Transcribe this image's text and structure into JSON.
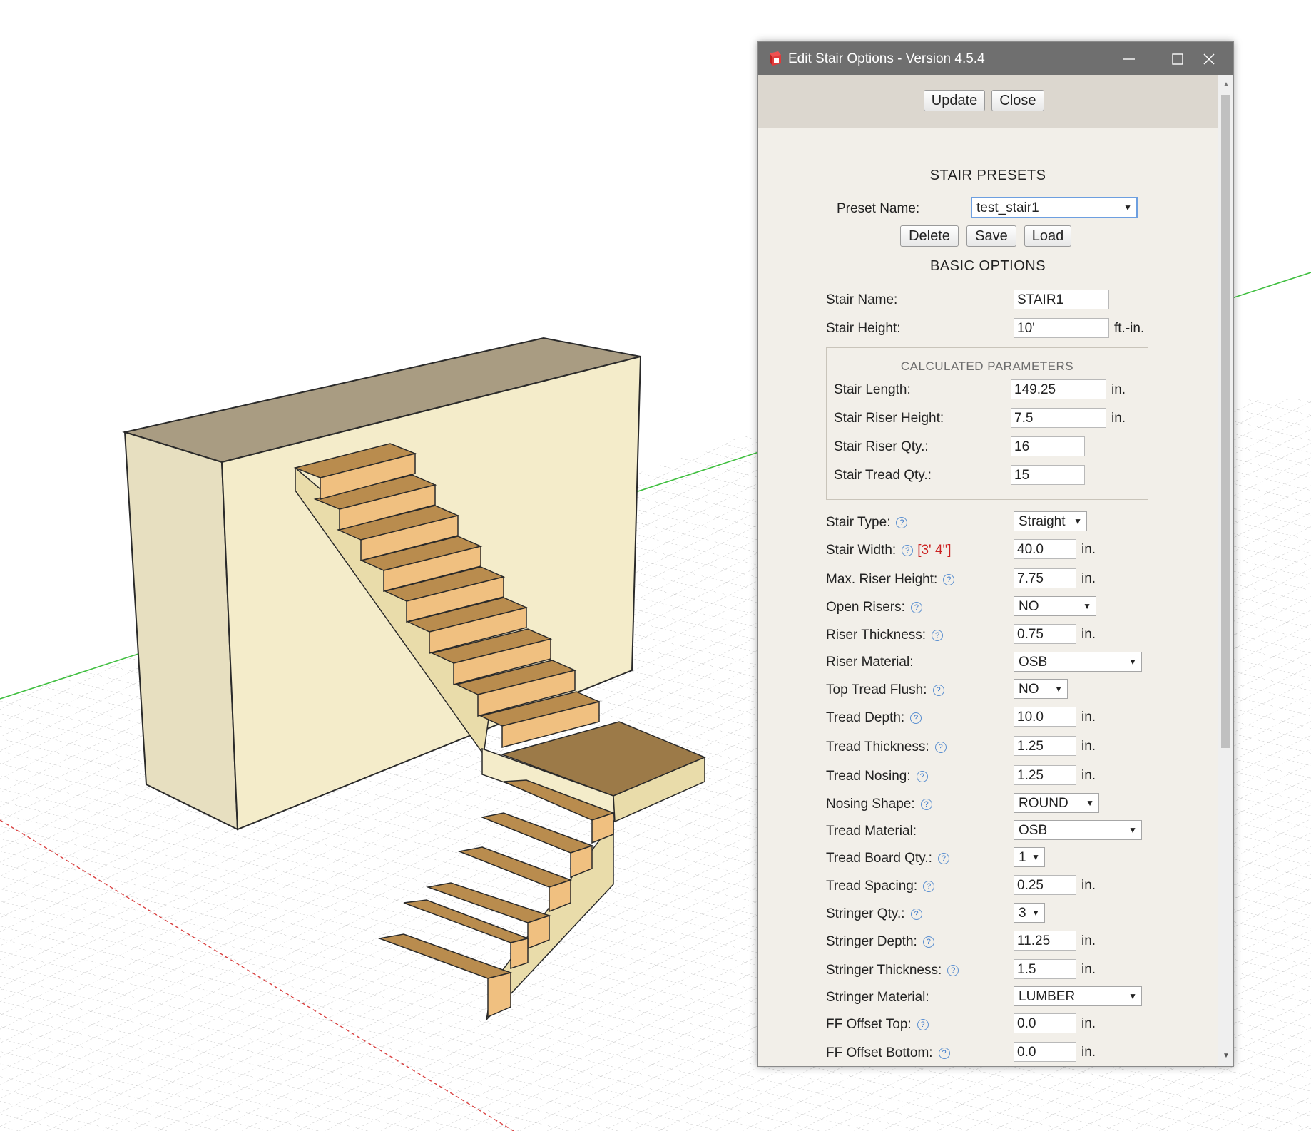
{
  "dialog": {
    "title": "Edit Stair Options - Version 4.5.4",
    "update_label": "Update",
    "close_label": "Close"
  },
  "presets": {
    "heading": "STAIR PRESETS",
    "preset_label": "Preset Name:",
    "preset_value": "test_stair1",
    "delete_label": "Delete",
    "save_label": "Save",
    "load_label": "Load"
  },
  "basic": {
    "heading": "BASIC OPTIONS",
    "stair_name_label": "Stair Name:",
    "stair_name_value": "STAIR1",
    "stair_height_label": "Stair Height:",
    "stair_height_value": "10'",
    "stair_height_unit": "ft.-in."
  },
  "calculated": {
    "heading": "CALCULATED PARAMETERS",
    "rows": [
      {
        "label": "Stair Length:",
        "value": "149.25",
        "unit": "in."
      },
      {
        "label": "Stair Riser Height:",
        "value": "7.5",
        "unit": "in."
      },
      {
        "label": "Stair Riser Qty.:",
        "value": "16"
      },
      {
        "label": "Stair Tread Qty.:",
        "value": "15"
      }
    ]
  },
  "options": {
    "stair_type": {
      "label": "Stair Type:",
      "value": "Straight"
    },
    "stair_width": {
      "label": "Stair Width:",
      "note": "[3' 4\"]",
      "value": "40.0",
      "unit": "in."
    },
    "max_riser_height": {
      "label": "Max. Riser Height:",
      "value": "7.75",
      "unit": "in."
    },
    "open_risers": {
      "label": "Open Risers:",
      "value": "NO"
    },
    "riser_thickness": {
      "label": "Riser Thickness:",
      "value": "0.75",
      "unit": "in."
    },
    "riser_material": {
      "label": "Riser Material:",
      "value": "OSB"
    },
    "top_tread_flush": {
      "label": "Top Tread Flush:",
      "value": "NO"
    },
    "tread_depth": {
      "label": "Tread Depth:",
      "value": "10.0",
      "unit": "in."
    },
    "tread_thickness": {
      "label": "Tread Thickness:",
      "value": "1.25",
      "unit": "in."
    },
    "tread_nosing": {
      "label": "Tread Nosing:",
      "value": "1.25",
      "unit": "in."
    },
    "nosing_shape": {
      "label": "Nosing Shape:",
      "value": "ROUND"
    },
    "tread_material": {
      "label": "Tread Material:",
      "value": "OSB"
    },
    "tread_board_qty": {
      "label": "Tread Board Qty.:",
      "value": "1"
    },
    "tread_spacing": {
      "label": "Tread Spacing:",
      "value": "0.25",
      "unit": "in."
    },
    "stringer_qty": {
      "label": "Stringer Qty.:",
      "value": "3"
    },
    "stringer_depth": {
      "label": "Stringer Depth:",
      "value": "11.25",
      "unit": "in."
    },
    "stringer_thickness": {
      "label": "Stringer Thickness:",
      "value": "1.5",
      "unit": "in."
    },
    "stringer_material": {
      "label": "Stringer Material:",
      "value": "LUMBER"
    },
    "ff_offset_top": {
      "label": "FF Offset Top:",
      "value": "0.0",
      "unit": "in."
    },
    "ff_offset_bottom": {
      "label": "FF Offset Bottom:",
      "value": "0.0",
      "unit": "in."
    }
  },
  "icons": {
    "help": "?",
    "dropdown": "▼",
    "scroll_up": "▲",
    "scroll_down": "▼"
  },
  "colors": {
    "title_bar": "#6f6f6f",
    "dialog_bg": "#f2efe9",
    "accent_red": "#cc2020",
    "help_blue": "#3d7bcc",
    "axis_green": "#3fbf3f",
    "axis_red": "#d94040"
  }
}
